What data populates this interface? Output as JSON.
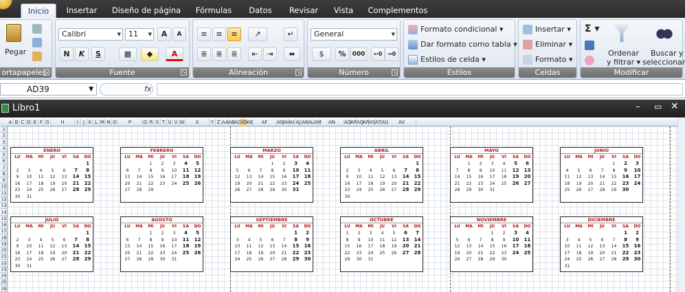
{
  "ribbon_tabs": [
    "Inicio",
    "Insertar",
    "Diseño de página",
    "Fórmulas",
    "Datos",
    "Revisar",
    "Vista",
    "Complementos"
  ],
  "clipboard": {
    "paste_label": "Pegar",
    "group_label": "ortapapeles"
  },
  "font": {
    "name": "Calibri",
    "size": "11",
    "group_label": "Fuente",
    "bold": "N",
    "italic": "K",
    "underline": "S",
    "grow": "A",
    "shrink": "A",
    "color_letter": "A"
  },
  "alignment": {
    "group_label": "Alineación"
  },
  "number": {
    "format": "General",
    "group_label": "Número",
    "percent": "%",
    "thousands": "000"
  },
  "styles": {
    "conditional": "Formato condicional",
    "as_table": "Dar formato como tabla",
    "cell_styles": "Estilos de celda",
    "group_label": "Estilos"
  },
  "cells": {
    "insert": "Insertar",
    "delete": "Eliminar",
    "format": "Formato",
    "group_label": "Celdas"
  },
  "editing": {
    "sum": "Σ",
    "sort_line1": "Ordenar",
    "sort_line2": "y filtrar",
    "find_line1": "Buscar y",
    "find_line2": "seleccionar",
    "group_label": "Modificar"
  },
  "formula_bar": {
    "name_box": "AD39",
    "fx": "fx",
    "formula": ""
  },
  "window": {
    "title": "Libro1"
  },
  "columns": [
    "A",
    "B",
    "C",
    "D",
    "E",
    "F",
    "G",
    "H",
    "I",
    "J",
    "K",
    "L",
    "M",
    "N",
    "O",
    "P",
    "Q",
    "R",
    "S",
    "T",
    "U",
    "V",
    "W",
    "X",
    "Y",
    "Z",
    "AA",
    "AB",
    "AC",
    "AD",
    "AE",
    "AF",
    "AG",
    "AH",
    "AI",
    "AJ",
    "AK",
    "AL",
    "AM",
    "AN",
    "AO",
    "AP",
    "AQ",
    "AR",
    "AS",
    "AT",
    "AU",
    "AV"
  ],
  "selected_column": "AD",
  "rows": [
    "1",
    "2",
    "3",
    "4",
    "5",
    "6",
    "7",
    "8",
    "9",
    "10",
    "11",
    "12",
    "13",
    "14",
    "15",
    "16",
    "17",
    "18",
    "19",
    "20",
    "21",
    "22",
    "23",
    "24",
    "25",
    "26"
  ],
  "weekdays": [
    "LU",
    "MA",
    "MI",
    "JU",
    "VI",
    "SA",
    "DO"
  ],
  "months": [
    {
      "name": "ENERO",
      "weeks": [
        [
          "",
          "",
          "",
          "",
          "",
          "",
          "1"
        ],
        [
          "2",
          "3",
          "4",
          "5",
          "6",
          "7",
          "8"
        ],
        [
          "9",
          "10",
          "11",
          "12",
          "13",
          "14",
          "15"
        ],
        [
          "16",
          "17",
          "18",
          "19",
          "20",
          "21",
          "22"
        ],
        [
          "23",
          "24",
          "25",
          "26",
          "27",
          "28",
          "29"
        ],
        [
          "30",
          "31",
          "",
          "",
          "",
          "",
          ""
        ]
      ]
    },
    {
      "name": "FEBRERO",
      "weeks": [
        [
          "",
          "",
          "1",
          "2",
          "3",
          "4",
          "5"
        ],
        [
          "6",
          "7",
          "8",
          "9",
          "10",
          "11",
          "12"
        ],
        [
          "13",
          "14",
          "15",
          "16",
          "17",
          "18",
          "19"
        ],
        [
          "20",
          "21",
          "22",
          "23",
          "24",
          "25",
          "26"
        ],
        [
          "27",
          "28",
          "29",
          "",
          "",
          "",
          ""
        ],
        [
          "",
          "",
          "",
          "",
          "",
          "",
          ""
        ]
      ]
    },
    {
      "name": "MARZO",
      "weeks": [
        [
          "",
          "",
          "",
          "1",
          "2",
          "3",
          "4"
        ],
        [
          "5",
          "6",
          "7",
          "8",
          "9",
          "10",
          "11"
        ],
        [
          "12",
          "13",
          "14",
          "15",
          "16",
          "17",
          "18"
        ],
        [
          "19",
          "20",
          "21",
          "22",
          "23",
          "24",
          "25"
        ],
        [
          "26",
          "27",
          "28",
          "29",
          "30",
          "31",
          ""
        ],
        [
          "",
          "",
          "",
          "",
          "",
          "",
          ""
        ]
      ]
    },
    {
      "name": "ABRIL",
      "weeks": [
        [
          "",
          "",
          "",
          "",
          "",
          "",
          "1"
        ],
        [
          "2",
          "3",
          "4",
          "5",
          "6",
          "7",
          "8"
        ],
        [
          "9",
          "10",
          "11",
          "12",
          "13",
          "14",
          "15"
        ],
        [
          "16",
          "17",
          "18",
          "19",
          "20",
          "21",
          "22"
        ],
        [
          "23",
          "24",
          "25",
          "26",
          "27",
          "28",
          "29"
        ],
        [
          "30",
          "",
          "",
          "",
          "",
          "",
          ""
        ]
      ]
    },
    {
      "name": "MAYO",
      "weeks": [
        [
          "",
          "1",
          "2",
          "3",
          "4",
          "5",
          "6"
        ],
        [
          "7",
          "8",
          "9",
          "10",
          "11",
          "12",
          "13"
        ],
        [
          "14",
          "15",
          "16",
          "17",
          "18",
          "19",
          "20"
        ],
        [
          "21",
          "22",
          "23",
          "24",
          "25",
          "26",
          "27"
        ],
        [
          "28",
          "29",
          "30",
          "31",
          "",
          "",
          ""
        ],
        [
          "",
          "",
          "",
          "",
          "",
          "",
          ""
        ]
      ]
    },
    {
      "name": "JUNIO",
      "weeks": [
        [
          "",
          "",
          "",
          "",
          "1",
          "2",
          "3"
        ],
        [
          "4",
          "5",
          "6",
          "7",
          "8",
          "9",
          "10"
        ],
        [
          "11",
          "12",
          "13",
          "14",
          "15",
          "16",
          "17"
        ],
        [
          "18",
          "19",
          "20",
          "21",
          "22",
          "23",
          "24"
        ],
        [
          "25",
          "26",
          "27",
          "28",
          "29",
          "30",
          ""
        ],
        [
          "",
          "",
          "",
          "",
          "",
          "",
          ""
        ]
      ]
    },
    {
      "name": "JULIO",
      "weeks": [
        [
          "",
          "",
          "",
          "",
          "",
          "",
          "1"
        ],
        [
          "2",
          "3",
          "4",
          "5",
          "6",
          "7",
          "8"
        ],
        [
          "9",
          "10",
          "11",
          "12",
          "13",
          "14",
          "15"
        ],
        [
          "16",
          "17",
          "18",
          "19",
          "20",
          "21",
          "22"
        ],
        [
          "23",
          "24",
          "25",
          "26",
          "27",
          "28",
          "29"
        ],
        [
          "30",
          "31",
          "",
          "",
          "",
          "",
          ""
        ]
      ]
    },
    {
      "name": "AGOSTO",
      "weeks": [
        [
          "",
          "",
          "1",
          "2",
          "3",
          "4",
          "5"
        ],
        [
          "6",
          "7",
          "8",
          "9",
          "10",
          "11",
          "12"
        ],
        [
          "13",
          "14",
          "15",
          "16",
          "17",
          "18",
          "19"
        ],
        [
          "20",
          "21",
          "22",
          "23",
          "24",
          "25",
          "26"
        ],
        [
          "27",
          "28",
          "29",
          "30",
          "31",
          "",
          ""
        ],
        [
          "",
          "",
          "",
          "",
          "",
          "",
          ""
        ]
      ]
    },
    {
      "name": "SEPTIEMBRE",
      "weeks": [
        [
          "",
          "",
          "",
          "",
          "",
          "1",
          "2"
        ],
        [
          "3",
          "4",
          "5",
          "6",
          "7",
          "8",
          "9"
        ],
        [
          "10",
          "11",
          "12",
          "13",
          "14",
          "15",
          "16"
        ],
        [
          "17",
          "18",
          "19",
          "20",
          "21",
          "22",
          "23"
        ],
        [
          "24",
          "25",
          "26",
          "27",
          "28",
          "29",
          "30"
        ],
        [
          "",
          "",
          "",
          "",
          "",
          "",
          ""
        ]
      ]
    },
    {
      "name": "OCTUBRE",
      "weeks": [
        [
          "1",
          "2",
          "3",
          "4",
          "5",
          "6",
          "7"
        ],
        [
          "8",
          "9",
          "10",
          "11",
          "12",
          "13",
          "14"
        ],
        [
          "15",
          "16",
          "17",
          "18",
          "19",
          "20",
          "21"
        ],
        [
          "22",
          "23",
          "24",
          "25",
          "26",
          "27",
          "28"
        ],
        [
          "29",
          "30",
          "31",
          "",
          "",
          "",
          ""
        ],
        [
          "",
          "",
          "",
          "",
          "",
          "",
          ""
        ]
      ]
    },
    {
      "name": "NOVIEMBRE",
      "weeks": [
        [
          "",
          "",
          "",
          "1",
          "2",
          "3",
          "4"
        ],
        [
          "5",
          "6",
          "7",
          "8",
          "9",
          "10",
          "11"
        ],
        [
          "12",
          "13",
          "14",
          "15",
          "16",
          "17",
          "18"
        ],
        [
          "19",
          "20",
          "21",
          "22",
          "23",
          "24",
          "25"
        ],
        [
          "26",
          "27",
          "28",
          "29",
          "30",
          "",
          ""
        ],
        [
          "",
          "",
          "",
          "",
          "",
          "",
          ""
        ]
      ]
    },
    {
      "name": "DICIEMBRE",
      "weeks": [
        [
          "",
          "",
          "",
          "",
          "",
          "1",
          "2"
        ],
        [
          "3",
          "4",
          "5",
          "6",
          "7",
          "8",
          "9"
        ],
        [
          "10",
          "11",
          "12",
          "13",
          "14",
          "15",
          "16"
        ],
        [
          "17",
          "18",
          "19",
          "20",
          "21",
          "22",
          "23"
        ],
        [
          "24",
          "25",
          "26",
          "27",
          "28",
          "29",
          "30"
        ],
        [
          "31",
          "",
          "",
          "",
          "",
          "",
          ""
        ]
      ]
    }
  ]
}
